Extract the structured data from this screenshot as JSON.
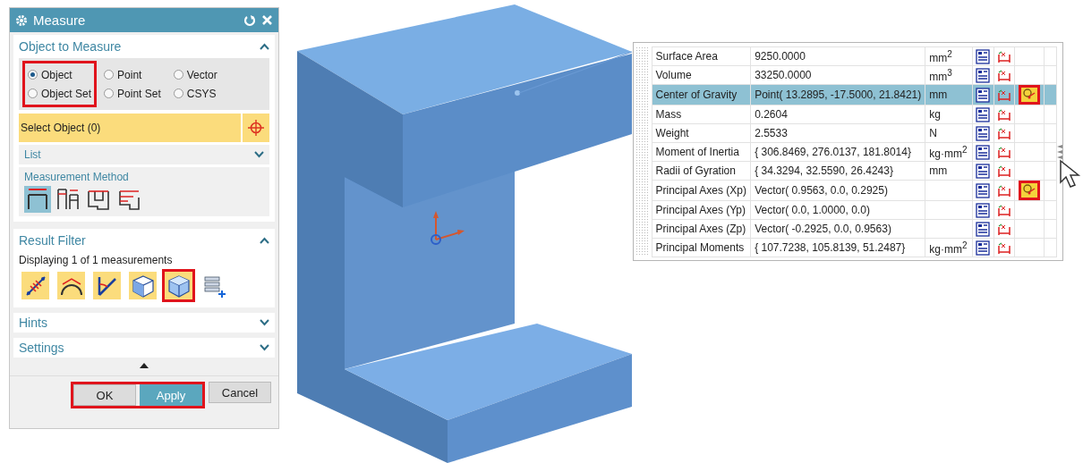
{
  "dialog": {
    "title": "Measure",
    "object_to_measure": {
      "title": "Object to Measure",
      "expanded": true,
      "radio_columns": [
        {
          "highlighted": true,
          "options": [
            {
              "label": "Object",
              "selected": true
            },
            {
              "label": "Object Set",
              "selected": false
            }
          ]
        },
        {
          "highlighted": false,
          "options": [
            {
              "label": "Point",
              "selected": false
            },
            {
              "label": "Point Set",
              "selected": false
            }
          ]
        },
        {
          "highlighted": false,
          "options": [
            {
              "label": "Vector",
              "selected": false
            },
            {
              "label": "CSYS",
              "selected": false
            }
          ]
        }
      ],
      "select_prompt": "Select Object (0)",
      "list": {
        "label": "List",
        "expanded": false
      },
      "method": {
        "label": "Measurement Method",
        "options": [
          {
            "kind": "simple",
            "selected": true
          },
          {
            "kind": "split",
            "selected": false
          },
          {
            "kind": "stepped",
            "selected": false
          },
          {
            "kind": "offset",
            "selected": false
          }
        ]
      }
    },
    "result_filter": {
      "title": "Result Filter",
      "expanded": true,
      "summary": "Displaying 1 of 1 measurements",
      "filters": [
        {
          "kind": "distance",
          "on": true,
          "highlighted": false
        },
        {
          "kind": "arc",
          "on": true,
          "highlighted": false
        },
        {
          "kind": "angle",
          "on": true,
          "highlighted": false
        },
        {
          "kind": "surface",
          "on": true,
          "highlighted": false
        },
        {
          "kind": "solid",
          "on": true,
          "highlighted": true
        },
        {
          "kind": "list",
          "on": false,
          "highlighted": false
        }
      ]
    },
    "collapsed_sections": [
      {
        "title": "Hints",
        "expanded": false
      },
      {
        "title": "Settings",
        "expanded": false
      }
    ],
    "buttons": [
      {
        "label": "OK",
        "kind": "default",
        "highlighted": true
      },
      {
        "label": "Apply",
        "kind": "primary",
        "highlighted": true
      },
      {
        "label": "Cancel",
        "kind": "default",
        "highlighted": false
      }
    ]
  },
  "results": {
    "rows": [
      {
        "property": "Surface Area",
        "value": "9250.0000",
        "unit": "mm$^{2}$",
        "selected": false,
        "marker": false
      },
      {
        "property": "Volume",
        "value": "33250.0000",
        "unit": "mm$^{3}$",
        "selected": false,
        "marker": false
      },
      {
        "property": "Center of Gravity",
        "value": "Point( 13.2895, -17.5000, 21.8421)",
        "unit": "mm",
        "selected": true,
        "marker": true
      },
      {
        "property": "Mass",
        "value": "0.2604",
        "unit": "kg",
        "selected": false,
        "marker": false
      },
      {
        "property": "Weight",
        "value": "2.5533",
        "unit": "N",
        "selected": false,
        "marker": false
      },
      {
        "property": "Moment of Inertia",
        "value": "{ 306.8469, 276.0137, 181.8014}",
        "unit": "kg·mm$^{2}$",
        "selected": false,
        "marker": false
      },
      {
        "property": "Radii of Gyration",
        "value": "{ 34.3294, 32.5590, 26.4243}",
        "unit": "mm",
        "selected": false,
        "marker": false
      },
      {
        "property": "Principal Axes (Xp)",
        "value": "Vector( 0.9563, 0.0, 0.2925)",
        "unit": "",
        "selected": false,
        "marker": true
      },
      {
        "property": "Principal Axes (Yp)",
        "value": "Vector( 0.0, 1.0000, 0.0)",
        "unit": "",
        "selected": false,
        "marker": false
      },
      {
        "property": "Principal Axes (Zp)",
        "value": "Vector( -0.2925, 0.0, 0.9563)",
        "unit": "",
        "selected": false,
        "marker": false
      },
      {
        "property": "Principal Moments",
        "value": "{ 107.7238, 105.8139, 51.2487}",
        "unit": "kg·mm$^{2}$",
        "selected": false,
        "marker": false
      }
    ]
  }
}
